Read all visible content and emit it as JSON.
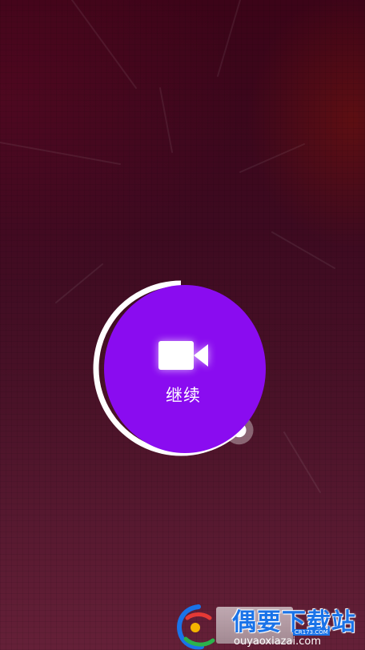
{
  "recorder": {
    "state": "paused",
    "button_label": "继续",
    "button_icon": "video-camera-icon",
    "progress_fraction": 0.62
  },
  "colors": {
    "button_fill": "#8a0cf0",
    "progress_ring": "#ffffff",
    "label_text": "#ffffff",
    "background_top": "#3c0418",
    "background_bottom": "#652038"
  },
  "watermark": {
    "site_name": "偶要下载站",
    "domain": "ouyaoxiazai.com",
    "sub_tag": "CR173.COM"
  }
}
